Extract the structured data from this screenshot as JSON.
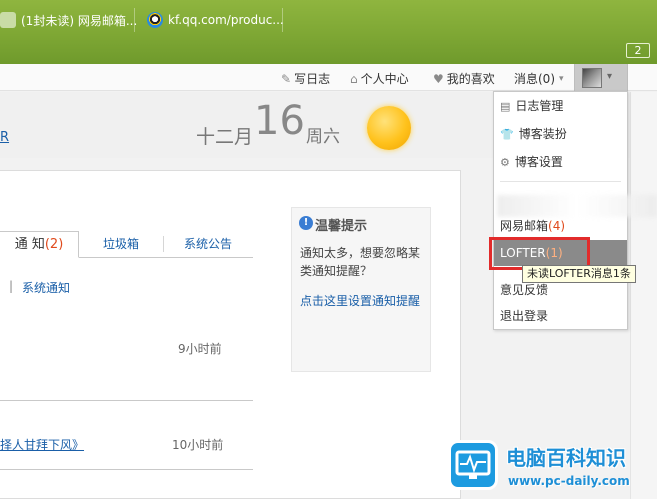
{
  "browser": {
    "tabs": [
      {
        "label": "(1封未读) 网易邮箱..."
      },
      {
        "label": "kf.qq.com/produc..."
      }
    ],
    "tab_count": "2"
  },
  "nav": {
    "write": "写日志",
    "personal": "个人中心",
    "likes": "我的喜欢",
    "messages": "消息(0)"
  },
  "header": {
    "link_fragment": "R",
    "month": "十二月",
    "day": "16",
    "weekday": "周六"
  },
  "tabs": {
    "notify_label": "通 知",
    "notify_count": "(2)",
    "spam": "垃圾箱",
    "announce": "系统公告"
  },
  "sub": {
    "pipe": "|",
    "system_notify": "系统通知"
  },
  "messages": [
    {
      "time": "9小时前"
    },
    {
      "text": "择人甘拜下风》",
      "time": "10小时前"
    }
  ],
  "tip": {
    "icon": "!",
    "title": "温馨提示",
    "body": "通知太多，想要忽略某类通知提醒？",
    "link": "点击这里设置通知提醒"
  },
  "menu": {
    "diary_manage": "日志管理",
    "blog_dress": "博客装扮",
    "blog_settings": "博客设置",
    "mail_label": "网易邮箱",
    "mail_count": "(4)",
    "lofter_label": "LOFTER",
    "lofter_count": "(1)",
    "feedback": "意见反馈",
    "logout": "退出登录"
  },
  "tooltip": "未读LOFTER消息1条",
  "watermark": {
    "name": "电脑百科知识",
    "url": "www.pc-daily.com"
  },
  "colors": {
    "browser_bar": "#7ea734",
    "link": "#1a5fa8",
    "highlight_box": "#e22b2b",
    "lofter_row": "#8a8a8a"
  }
}
